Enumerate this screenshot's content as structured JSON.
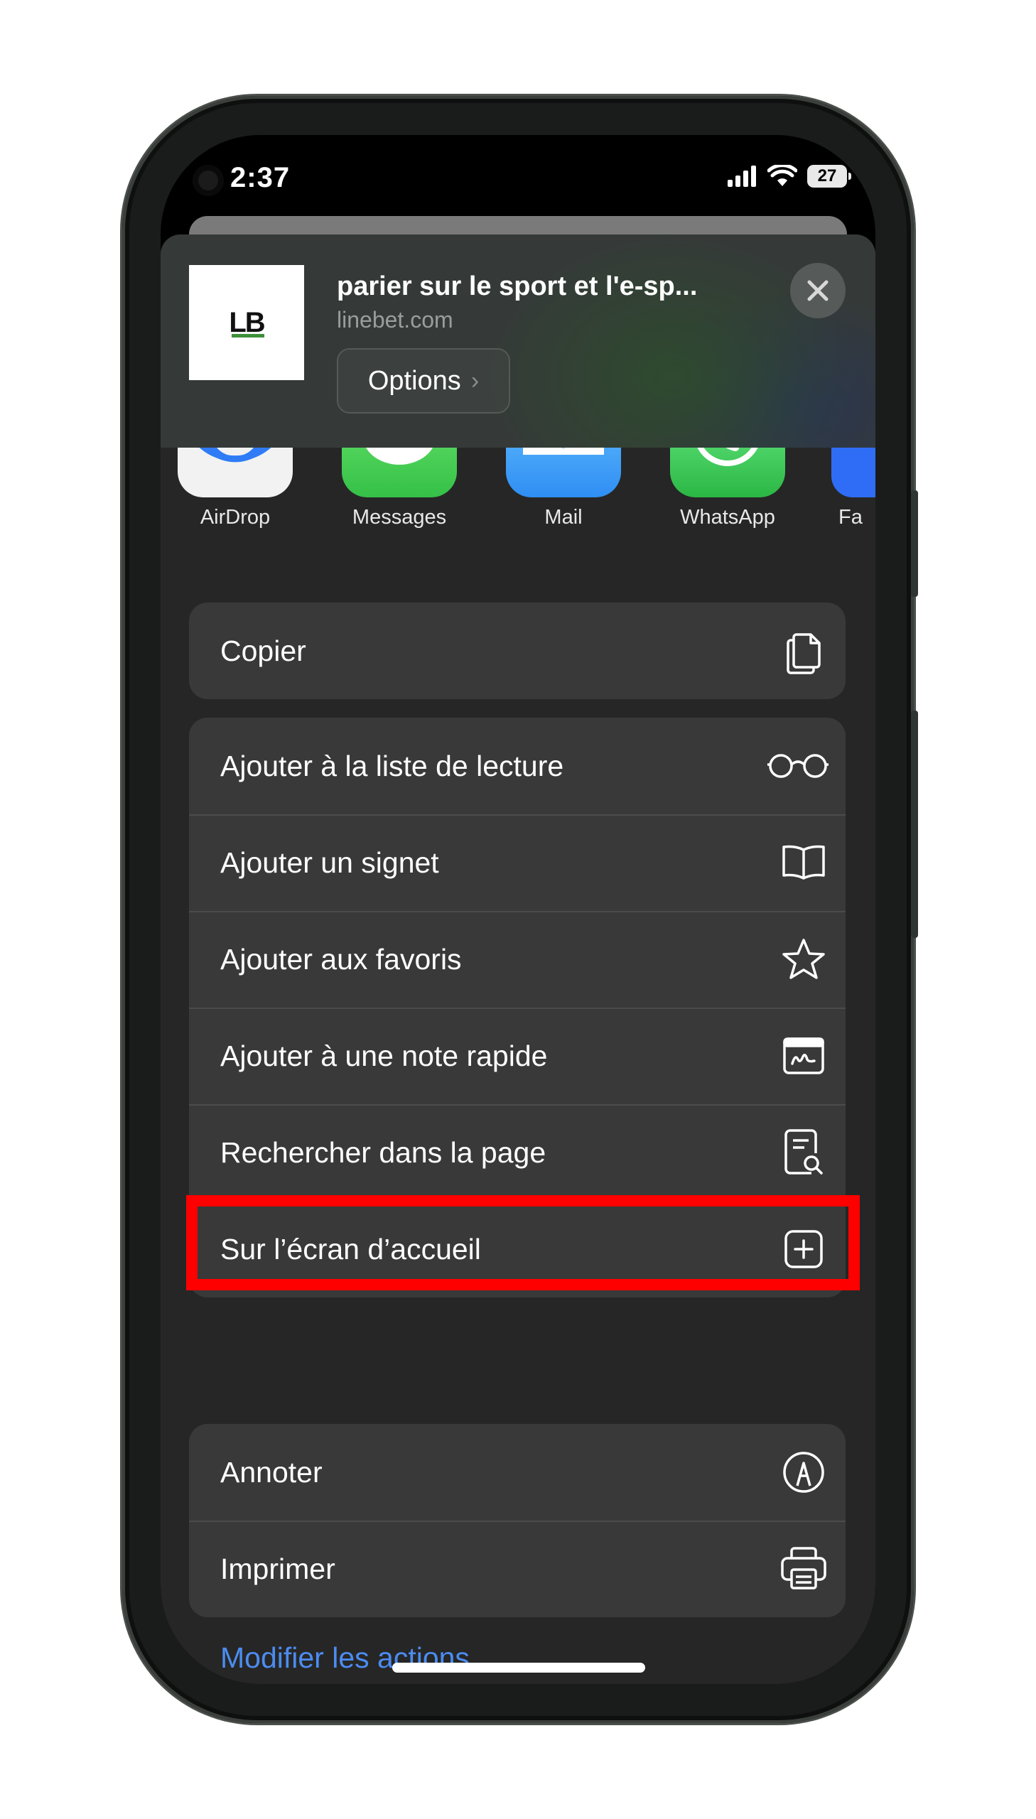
{
  "status_bar": {
    "time": "2:37",
    "battery": "27"
  },
  "share_header": {
    "logo_text": "LB",
    "title": "parier sur le sport et l'e-sp...",
    "url": "linebet.com",
    "options_label": "Options"
  },
  "apps": [
    {
      "label": "AirDrop",
      "icon": "airdrop-icon"
    },
    {
      "label": "Messages",
      "icon": "messages-icon"
    },
    {
      "label": "Mail",
      "icon": "mail-icon"
    },
    {
      "label": "WhatsApp",
      "icon": "whatsapp-icon"
    },
    {
      "label": "Fa",
      "icon": "facebook-icon"
    }
  ],
  "actions": {
    "copy": "Copier",
    "reading_list": "Ajouter à la liste de lecture",
    "bookmark": "Ajouter un signet",
    "favorites": "Ajouter aux favoris",
    "quick_note": "Ajouter à une note rapide",
    "find_in_page": "Rechercher dans la page",
    "home_screen": "Sur l’écran d’accueil",
    "markup": "Annoter",
    "print": "Imprimer"
  },
  "edit_actions_label": "Modifier les actions...",
  "colors": {
    "highlight": "#ff0000",
    "link": "#4c8cf0",
    "group_bg": "#393939",
    "sheet_bg": "#262626"
  }
}
